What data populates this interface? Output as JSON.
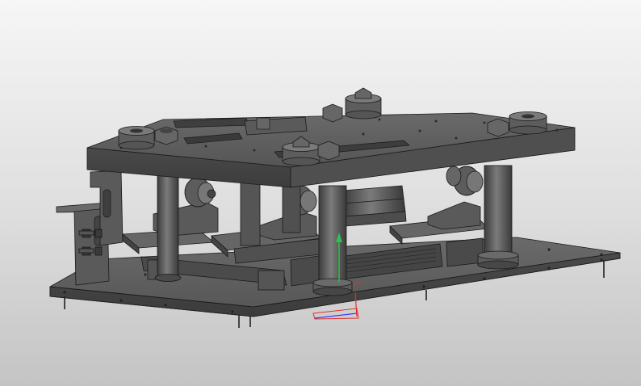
{
  "viewport": {
    "kind": "cad-3d-viewport",
    "background_top": "#f6f6f6",
    "background_bottom": "#c4c4c4"
  },
  "model": {
    "body_color": "#5d5d5d",
    "edge_color": "#1a1a1a",
    "highlight_color": "#8a8a8a"
  },
  "rail_labels": {
    "left_line1": "",
    "left_line2": "",
    "right_line1": "",
    "right_line2": ""
  },
  "triad": {
    "x_axis_color": "#e03030",
    "y_axis_color": "#2fc24a",
    "z_axis_color": "#3b3bff",
    "plane_color": "#5050c8"
  }
}
